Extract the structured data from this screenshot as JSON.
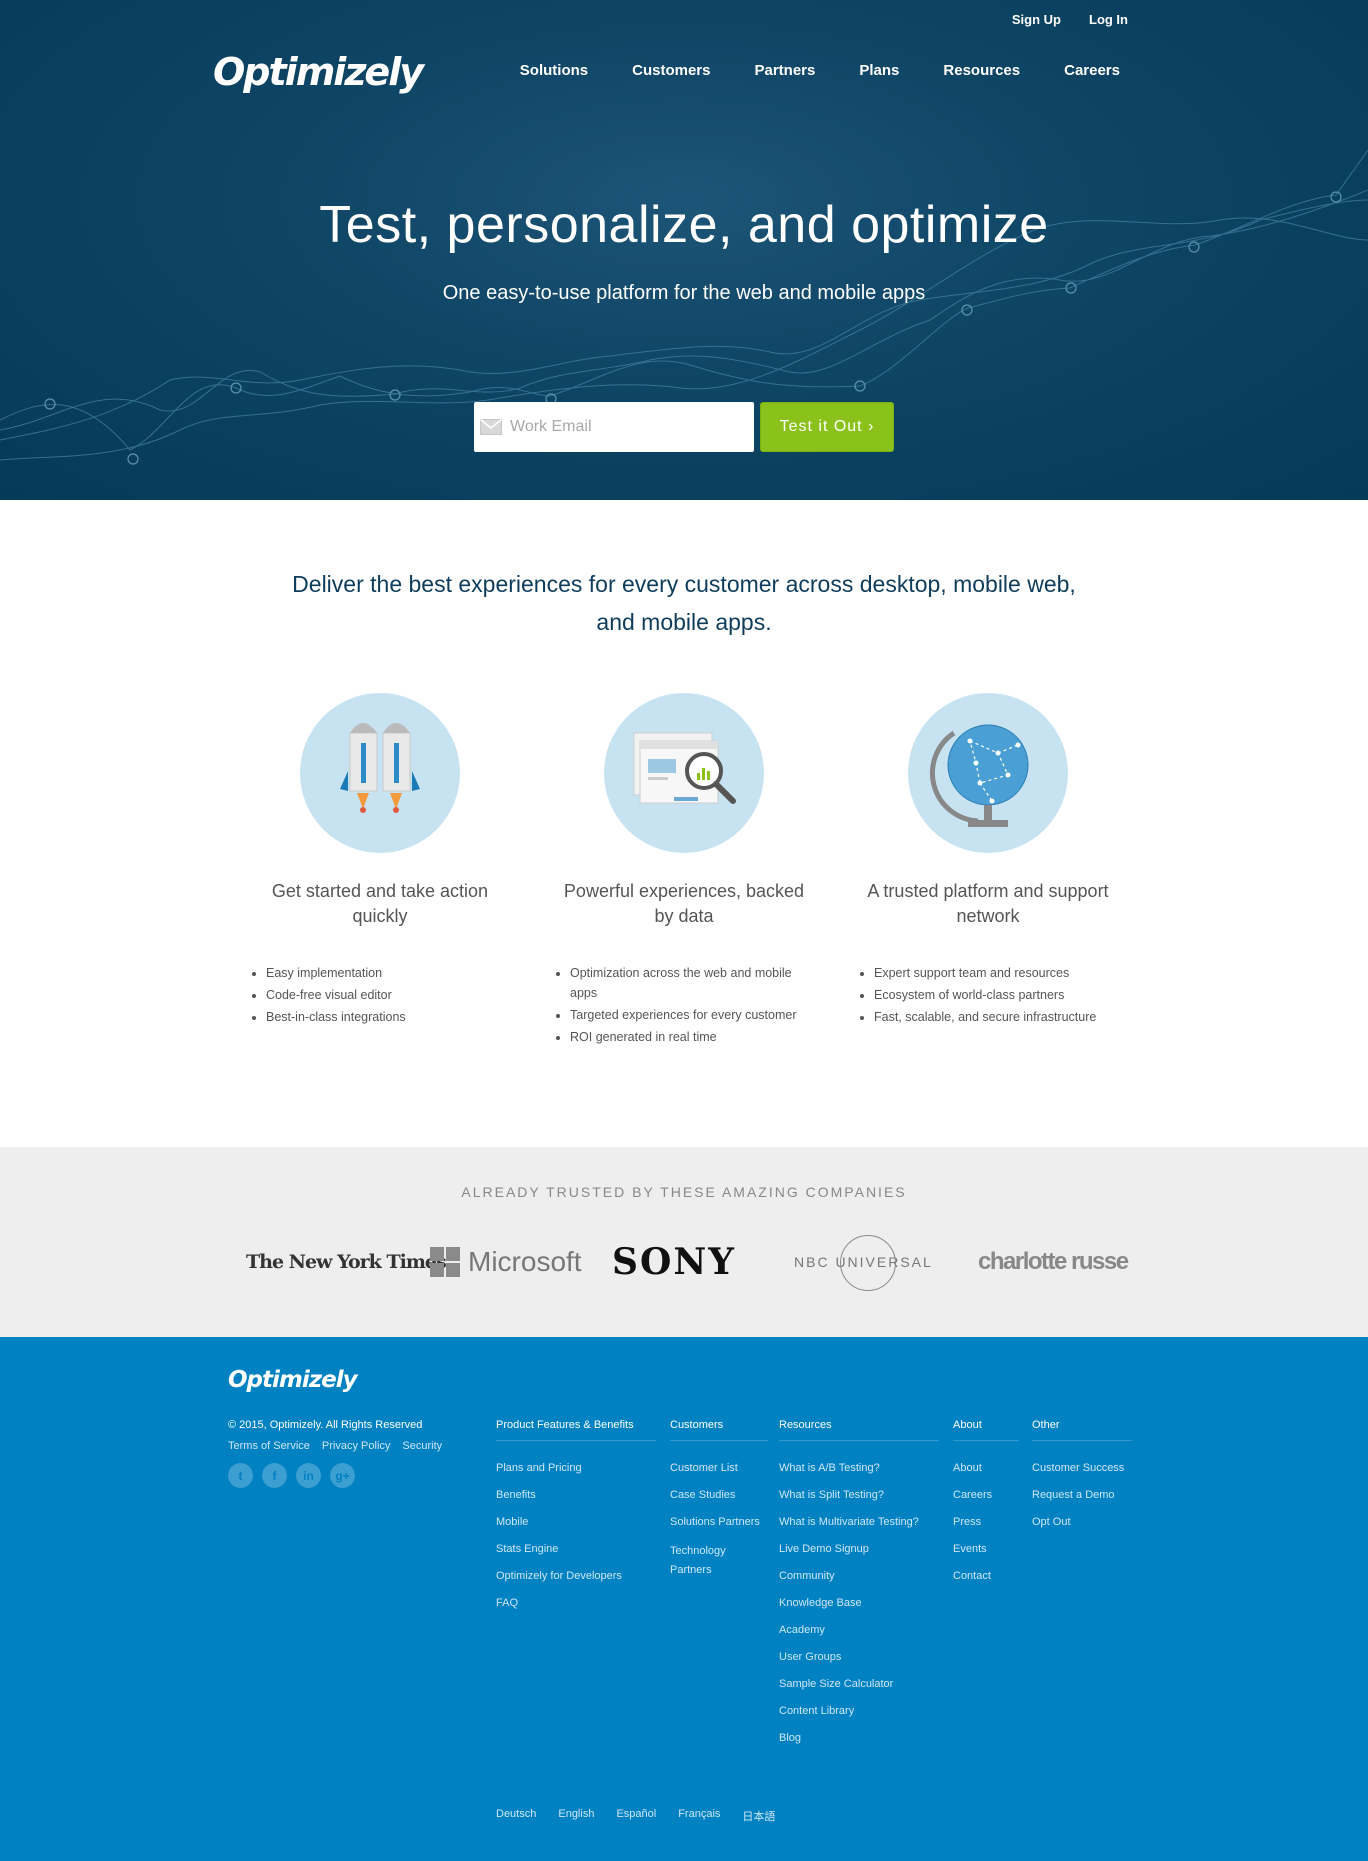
{
  "header": {
    "top_links": [
      "Sign Up",
      "Log In"
    ],
    "logo": "Optimizely",
    "nav": [
      "Solutions",
      "Customers",
      "Partners",
      "Plans",
      "Resources",
      "Careers"
    ]
  },
  "hero": {
    "title": "Test, personalize, and optimize",
    "subtitle": "One easy-to-use platform for the web and mobile apps",
    "email_placeholder": "Work Email",
    "cta": "Test it Out ›"
  },
  "intro": "Deliver the best experiences for every customer across desktop, mobile web, and mobile apps.",
  "features": [
    {
      "title": "Get started and take action quickly",
      "bullets": [
        "Easy implementation",
        "Code-free visual editor",
        "Best-in-class integrations"
      ]
    },
    {
      "title": "Powerful experiences, backed by data",
      "bullets": [
        "Optimization across the web and mobile apps",
        "Targeted experiences for every customer",
        "ROI generated in real time"
      ]
    },
    {
      "title": "A trusted platform and support network",
      "bullets": [
        "Expert support team and resources",
        "Ecosystem of world-class partners",
        "Fast, scalable, and secure infrastructure"
      ]
    }
  ],
  "trusted": {
    "caption": "ALREADY TRUSTED BY THESE AMAZING COMPANIES",
    "logos": [
      "The New York Times",
      "Microsoft",
      "SONY",
      "NBC UNIVERSAL",
      "charlotte russe"
    ]
  },
  "footer": {
    "logo": "Optimizely",
    "copyright": "© 2015, Optimizely. All Rights Reserved",
    "legal": [
      "Terms of Service",
      "Privacy Policy",
      "Security"
    ],
    "social": [
      "twitter-icon",
      "facebook-icon",
      "linkedin-icon",
      "googleplus-icon"
    ],
    "columns": [
      {
        "heading": "Product Features & Benefits",
        "links": [
          "Plans and Pricing",
          "Benefits",
          "Mobile",
          "Stats Engine",
          "Optimizely for Developers",
          "FAQ"
        ]
      },
      {
        "heading": "Customers",
        "links": [
          "Customer List",
          "Case Studies",
          "Solutions Partners",
          "Technology Partners"
        ]
      },
      {
        "heading": "Resources",
        "links": [
          "What is A/B Testing?",
          "What is Split Testing?",
          "What is Multivariate Testing?",
          "Live Demo Signup",
          "Community",
          "Knowledge Base",
          "Academy",
          "User Groups",
          "Sample Size Calculator",
          "Content Library",
          "Blog"
        ]
      },
      {
        "heading": "About",
        "links": [
          "About",
          "Careers",
          "Press",
          "Events",
          "Contact"
        ]
      },
      {
        "heading": "Other",
        "links": [
          "Customer Success",
          "Request a Demo",
          "Opt Out"
        ]
      }
    ],
    "languages": [
      "Deutsch",
      "English",
      "Español",
      "Français",
      "日本語"
    ]
  },
  "colors": {
    "hero_bg": "#0f4565",
    "cta_green": "#8ac11a",
    "footer_blue": "#0081c1",
    "trusted_bg": "#eeeeee",
    "feature_circle": "#c7e3f1"
  }
}
